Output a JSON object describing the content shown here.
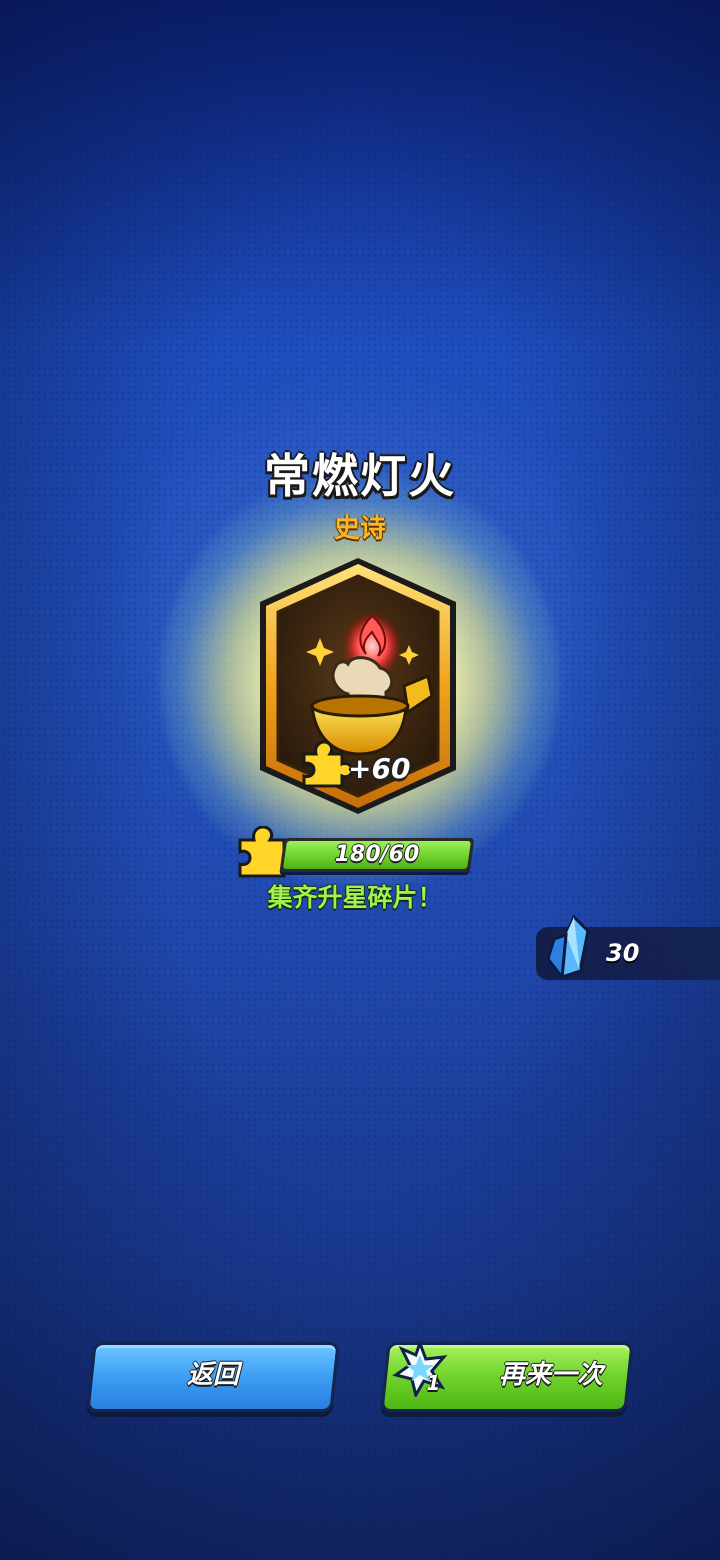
{
  "reward": {
    "item_name": "常燃灯火",
    "rarity": "史诗",
    "shard_gain": "+60"
  },
  "progress": {
    "label": "180/60",
    "current": 180,
    "required": 60,
    "fill_fraction": 1.0
  },
  "hint": "集齐升星碎片！",
  "currency": {
    "value": "30",
    "icon": "blue-crystal-icon"
  },
  "buttons": {
    "back_label": "返回",
    "again_label": "再来一次",
    "again_cost": "1",
    "again_icon": "star-ticket-icon"
  },
  "colors": {
    "rarity_epic": "#ffb623",
    "hint_green": "#a4f04d",
    "button_blue": "#3d9ef4",
    "button_green": "#6fd22a"
  }
}
